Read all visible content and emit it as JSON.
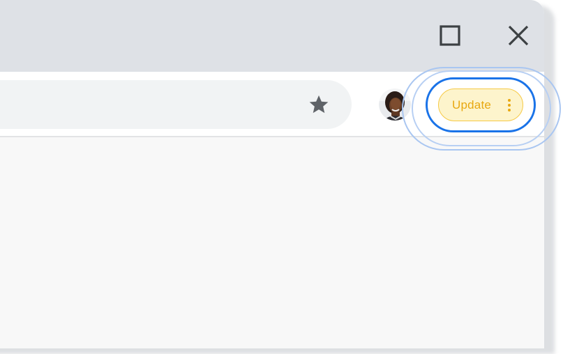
{
  "window_controls": {
    "minimize_icon": "minimize-icon",
    "maximize_icon": "maximize-icon",
    "close_icon": "close-icon"
  },
  "toolbar": {
    "bookmark_icon": "star-icon",
    "profile_icon": "avatar",
    "update_button": {
      "label": "Update",
      "menu_icon": "more-vertical-icon"
    }
  },
  "colors": {
    "titlebar": "#dee1e6",
    "omnibox": "#f1f3f4",
    "update_fill": "#fdf4cc",
    "update_border": "#f6c945",
    "update_text": "#e8a810",
    "focus_ring": "#1a73e8"
  }
}
